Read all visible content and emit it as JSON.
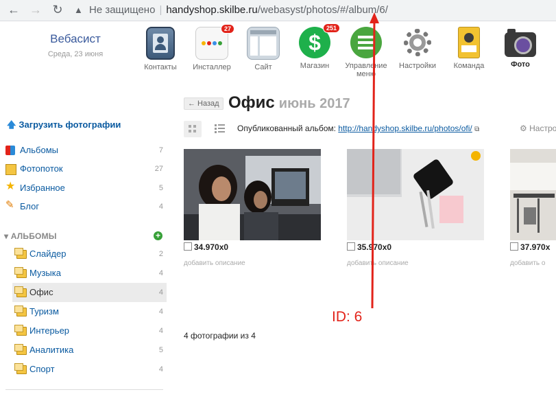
{
  "browser": {
    "insecure_label": "Не защищено",
    "url_host": "handyshop.skilbe.ru",
    "url_path": "/webasyst/photos/#/album/6/"
  },
  "brand": {
    "name": "Вебасист",
    "date": "Среда, 23 июня"
  },
  "apps": [
    {
      "label": "Контакты",
      "icon": "contacts-icon"
    },
    {
      "label": "Инсталлер",
      "icon": "installer-icon",
      "badge": "27"
    },
    {
      "label": "Сайт",
      "icon": "site-icon"
    },
    {
      "label": "Магазин",
      "icon": "shop-icon",
      "badge": "251"
    },
    {
      "label": "Управление меню",
      "icon": "menu-icon"
    },
    {
      "label": "Настройки",
      "icon": "gear-icon"
    },
    {
      "label": "Команда",
      "icon": "team-icon"
    },
    {
      "label": "Фото",
      "icon": "camera-icon"
    }
  ],
  "sidebar": {
    "upload_label": "Загрузить фотографии",
    "items": [
      {
        "label": "Альбомы",
        "count": "7"
      },
      {
        "label": "Фотопоток",
        "count": "27"
      },
      {
        "label": "Избранное",
        "count": "5"
      },
      {
        "label": "Блог",
        "count": "4"
      }
    ],
    "albums_heading": "▾ АЛЬБОМЫ",
    "albums": [
      {
        "label": "Слайдер",
        "count": "2"
      },
      {
        "label": "Музыка",
        "count": "4"
      },
      {
        "label": "Офис",
        "count": "4"
      },
      {
        "label": "Туризм",
        "count": "4"
      },
      {
        "label": "Интерьер",
        "count": "4"
      },
      {
        "label": "Аналитика",
        "count": "5"
      },
      {
        "label": "Спорт",
        "count": "4"
      }
    ]
  },
  "main": {
    "back_label": "← Назад",
    "title": "Офис",
    "title_date": "июнь 2017",
    "published_label": "Опубликованный альбом:",
    "published_url": "http://handyshop.skilbe.ru/photos/ofi/",
    "settings_label": "Настро",
    "photos": [
      {
        "dim": "34.970x0",
        "desc": "добавить описание"
      },
      {
        "dim": "35.970x0",
        "desc": "добавить описание"
      },
      {
        "dim": "37.970x",
        "desc": "добавить о"
      }
    ],
    "count_label": "4 фотографии из 4"
  },
  "annotation": {
    "text": "ID: 6",
    "color": "#e2231a"
  }
}
